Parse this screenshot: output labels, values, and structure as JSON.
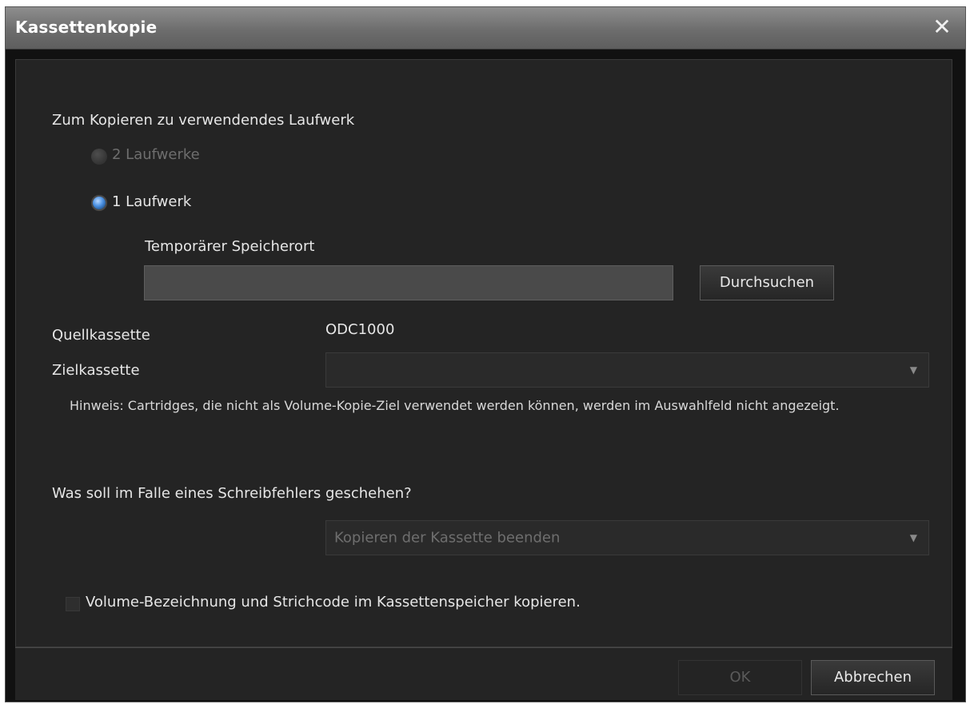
{
  "window": {
    "title": "Kassettenkopie",
    "close_glyph": "✕"
  },
  "drive": {
    "heading": "Zum Kopieren zu verwendendes Laufwerk",
    "option_two_drives": "2 Laufwerke",
    "option_one_drive": "1 Laufwerk",
    "selected": "1 Laufwerk",
    "temp_location_label": "Temporärer Speicherort",
    "temp_location_value": "",
    "browse_label": "Durchsuchen"
  },
  "source": {
    "label": "Quellkassette",
    "value": "ODC1000"
  },
  "target": {
    "label": "Zielkassette",
    "value": ""
  },
  "note": "Hinweis: Cartridges, die nicht als Volume-Kopie-Ziel verwendet werden können, werden im Auswahlfeld nicht angezeigt.",
  "write_error": {
    "question": "Was soll im Falle eines Schreibfehlers geschehen?",
    "selected": "Kopieren der Kassette beenden"
  },
  "copy_volume": {
    "label": "Volume-Bezeichnung und Strichcode im Kassettenspeicher kopieren.",
    "checked": false
  },
  "footer": {
    "ok_label": "OK",
    "cancel_label": "Abbrechen"
  },
  "colors": {
    "accent_radio": "#4a90e2",
    "background": "#242424",
    "text": "#e6e6e6"
  },
  "icons": {
    "close": "close-icon",
    "dropdown": "chevron-down-icon"
  }
}
